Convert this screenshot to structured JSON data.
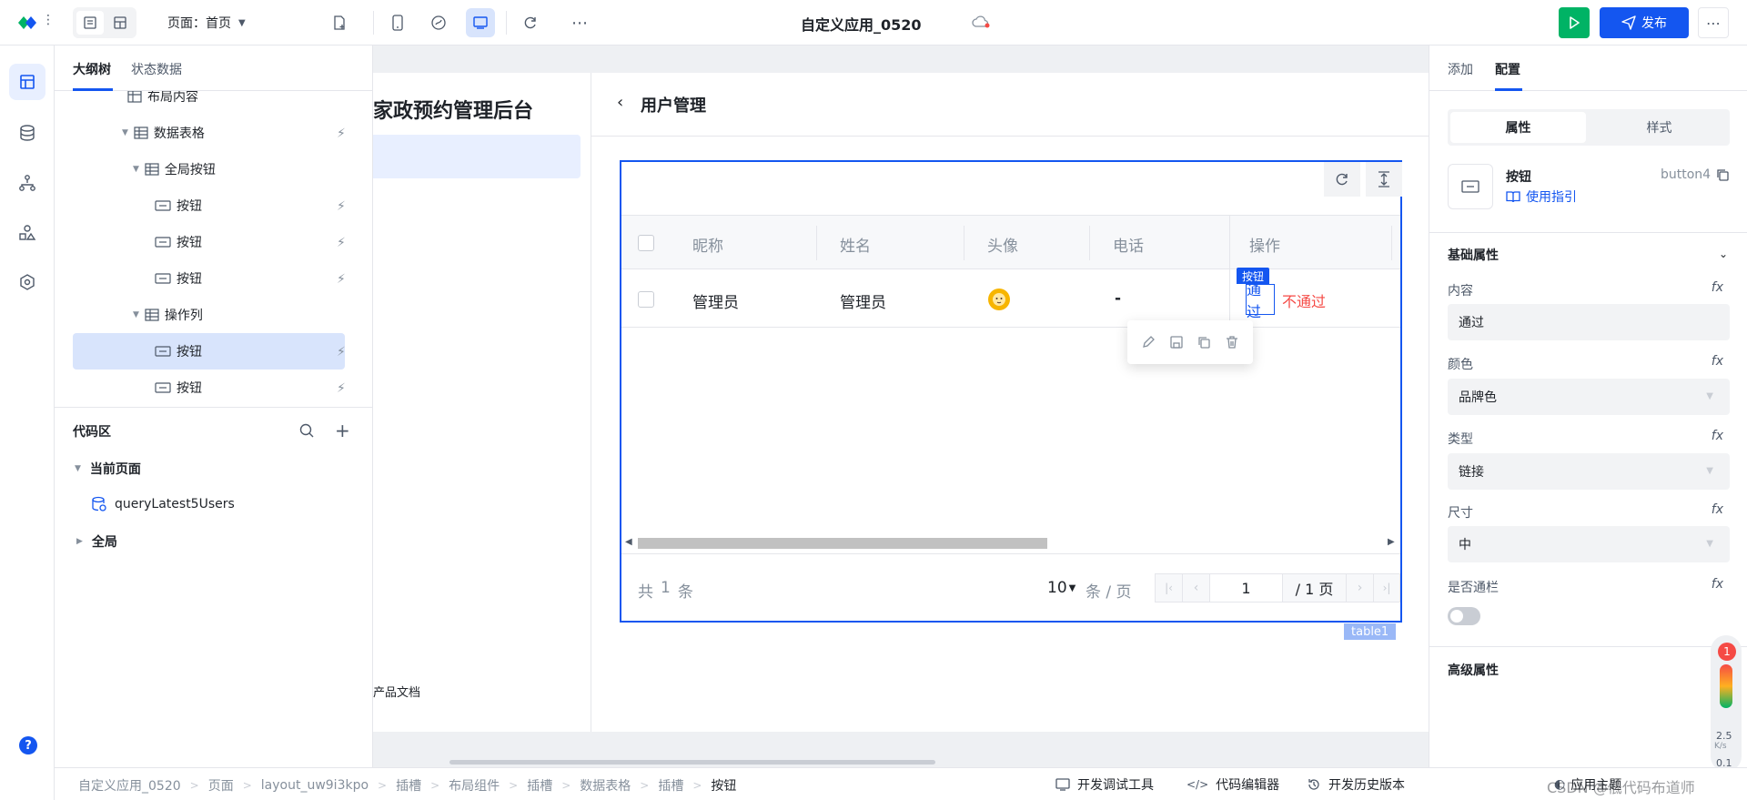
{
  "topbar": {
    "page_label": "页面：首页",
    "app_title": "自定义应用_0520",
    "publish_label": "发布",
    "more_label": "⋯"
  },
  "left_panel": {
    "tabs": [
      "大纲树",
      "状态数据"
    ],
    "tree": [
      {
        "label": "布局内容"
      },
      {
        "label": "数据表格"
      },
      {
        "label": "全局按钮"
      },
      {
        "label": "按钮"
      },
      {
        "label": "按钮"
      },
      {
        "label": "按钮"
      },
      {
        "label": "操作列"
      },
      {
        "label": "按钮"
      },
      {
        "label": "按钮"
      }
    ],
    "code_area_title": "代码区",
    "current_page": "当前页面",
    "query_name": "queryLatest5Users",
    "global": "全局"
  },
  "canvas": {
    "app_name": "家政预约管理后台",
    "page_title": "用户管理",
    "doc_link": "产品文档",
    "table": {
      "columns": [
        "昵称",
        "姓名",
        "头像",
        "电话",
        "操作"
      ],
      "rows": [
        {
          "nickname": "管理员",
          "name": "管理员",
          "phone": "-",
          "action1": "通过",
          "action2": "不通过"
        }
      ],
      "total_prefix": "共",
      "total_count": "1",
      "total_suffix": "条",
      "page_size": "10",
      "page_size_unit": "条 / 页",
      "current_page": "1",
      "total_pages": "/ 1 页",
      "tag": "table1",
      "selected_tag": "按钮"
    }
  },
  "right_panel": {
    "tabs": [
      "添加",
      "配置"
    ],
    "sub_tabs": [
      "属性",
      "样式"
    ],
    "component_name": "按钮",
    "component_id": "button4",
    "guide_link": "使用指引",
    "section_basic": "基础属性",
    "section_advanced": "高级属性",
    "fields": {
      "content_label": "内容",
      "content_value": "通过",
      "color_label": "颜色",
      "color_value": "品牌色",
      "type_label": "类型",
      "type_value": "链接",
      "size_label": "尺寸",
      "size_value": "中",
      "full_width_label": "是否通栏"
    },
    "fx": "fx"
  },
  "statusbar": {
    "breadcrumbs": [
      "自定义应用_0520",
      "页面",
      "layout_uw9i3kpo",
      "插槽",
      "布局组件",
      "插槽",
      "数据表格",
      "插槽",
      "按钮"
    ],
    "debug_tool": "开发调试工具",
    "code_editor": "代码编辑器",
    "history": "开发历史版本",
    "app_theme": "应用主题",
    "watermark": "CSDN @低代码布道师"
  },
  "widget": {
    "badge": "1",
    "speed_up": "2.5",
    "speed_unit": "K/s",
    "speed_down": "0.1"
  },
  "colors": {
    "brand": "#1456f0",
    "green": "#00b365",
    "danger": "#f54a45",
    "selected_bg": "#d8e4fc"
  }
}
